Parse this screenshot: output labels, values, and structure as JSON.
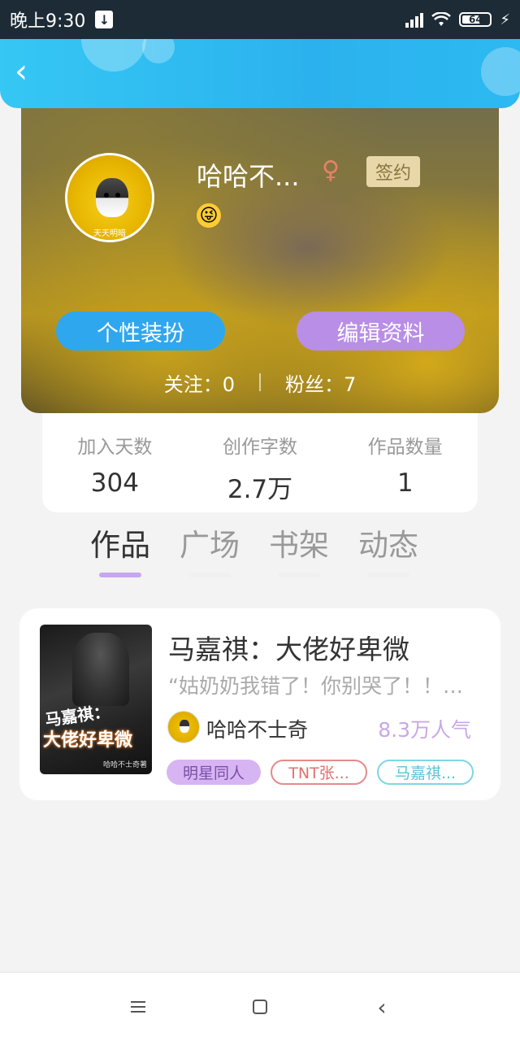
{
  "status_bar": {
    "time": "晚上9:30",
    "battery": "64"
  },
  "profile": {
    "username": "哈哈不...",
    "gender_icon": "female-icon",
    "signed_badge": "签约",
    "avatar_watermark": "天天明暗",
    "decorate_button": "个性装扮",
    "edit_button": "编辑资料",
    "following": "关注：0",
    "followers": "粉丝：7"
  },
  "stats": [
    {
      "label": "加入天数",
      "value": "304"
    },
    {
      "label": "创作字数",
      "value": "2.7万"
    },
    {
      "label": "作品数量",
      "value": "1"
    }
  ],
  "tabs": [
    {
      "label": "作品",
      "active": true
    },
    {
      "label": "广场",
      "active": false
    },
    {
      "label": "书架",
      "active": false
    },
    {
      "label": "动态",
      "active": false
    }
  ],
  "work": {
    "title": "马嘉祺：大佬好卑微",
    "excerpt": "“姑奶奶我错了！你别哭了！！…",
    "author": "哈哈不士奇",
    "popularity": "8.3万人气",
    "cover_text_1": "马嘉祺：",
    "cover_text_2": "大佬好卑微",
    "cover_text_3": "哈哈不士奇著",
    "tags": [
      "明星同人",
      "TNT张...",
      "马嘉祺..."
    ]
  },
  "colors": {
    "header": "#2bb2ee",
    "decorate_button": "#2fa7ee",
    "edit_button": "#b88ee6",
    "tab_underline_active": "#c7a7eb",
    "popularity": "#c8a8e6"
  }
}
